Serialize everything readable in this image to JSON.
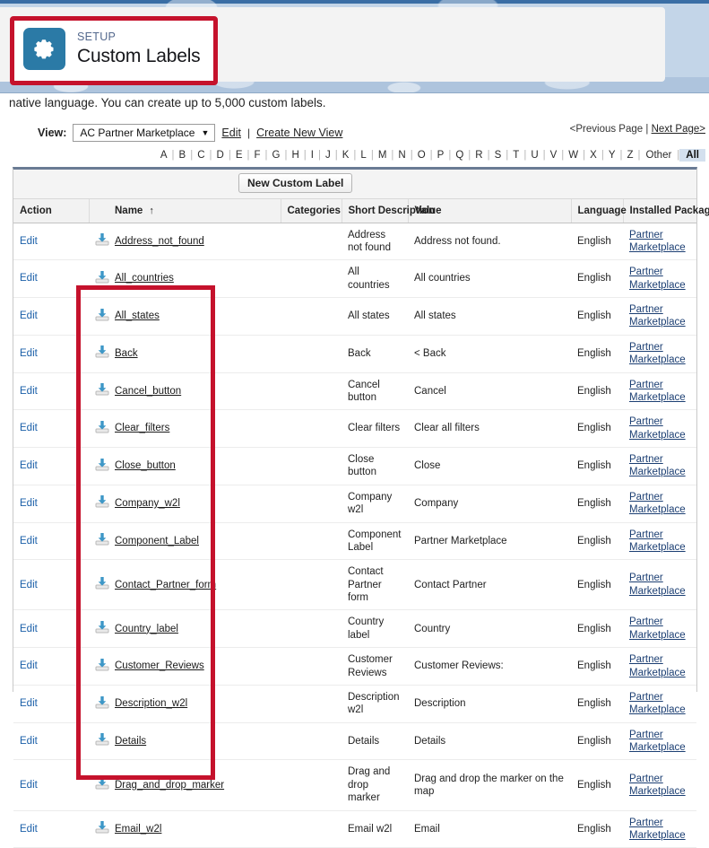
{
  "header": {
    "eyebrow": "SETUP",
    "title": "Custom Labels",
    "gear_icon": "gear-icon"
  },
  "intro": {
    "text": "native language. You can create up to 5,000 custom labels."
  },
  "view_bar": {
    "label": "View:",
    "selected_view": "AC Partner Marketplace",
    "caret": "▼",
    "edit_label": "Edit",
    "separator": "|",
    "create_view_label": "Create New View"
  },
  "paging": {
    "previous": "<Previous Page",
    "separator": "|",
    "next": "Next Page>"
  },
  "alpha_filter": {
    "letters": [
      "A",
      "B",
      "C",
      "D",
      "E",
      "F",
      "G",
      "H",
      "I",
      "J",
      "K",
      "L",
      "M",
      "N",
      "O",
      "P",
      "Q",
      "R",
      "S",
      "T",
      "U",
      "V",
      "W",
      "X",
      "Y",
      "Z"
    ],
    "other_label": "Other",
    "all_label": "All",
    "active": "All"
  },
  "toolbar": {
    "new_label_button": "New Custom Label"
  },
  "table": {
    "columns": [
      "Action",
      "",
      "Name",
      "Categories",
      "Short Description",
      "Value",
      "Language",
      "Installed Package"
    ],
    "sort_indicator": "↑",
    "sorted_column": "Name",
    "rows": [
      {
        "action": "Edit",
        "name": "Address_not_found",
        "categories": "",
        "short_description": "Address not found",
        "value": "Address not found.",
        "language": "English",
        "package": "Partner Marketplace"
      },
      {
        "action": "Edit",
        "name": "All_countries",
        "categories": "",
        "short_description": "All countries",
        "value": "All countries",
        "language": "English",
        "package": "Partner Marketplace"
      },
      {
        "action": "Edit",
        "name": "All_states",
        "categories": "",
        "short_description": "All states",
        "value": "All states",
        "language": "English",
        "package": "Partner Marketplace"
      },
      {
        "action": "Edit",
        "name": "Back",
        "categories": "",
        "short_description": "Back",
        "value": "< Back",
        "language": "English",
        "package": "Partner Marketplace"
      },
      {
        "action": "Edit",
        "name": "Cancel_button",
        "categories": "",
        "short_description": "Cancel button",
        "value": "Cancel",
        "language": "English",
        "package": "Partner Marketplace"
      },
      {
        "action": "Edit",
        "name": "Clear_filters",
        "categories": "",
        "short_description": "Clear filters",
        "value": "Clear all filters",
        "language": "English",
        "package": "Partner Marketplace"
      },
      {
        "action": "Edit",
        "name": "Close_button",
        "categories": "",
        "short_description": "Close button",
        "value": "Close",
        "language": "English",
        "package": "Partner Marketplace"
      },
      {
        "action": "Edit",
        "name": "Company_w2l",
        "categories": "",
        "short_description": "Company w2l",
        "value": "Company",
        "language": "English",
        "package": "Partner Marketplace"
      },
      {
        "action": "Edit",
        "name": "Component_Label",
        "categories": "",
        "short_description": "Component Label",
        "value": "Partner Marketplace",
        "language": "English",
        "package": "Partner Marketplace"
      },
      {
        "action": "Edit",
        "name": "Contact_Partner_form",
        "categories": "",
        "short_description": "Contact Partner form",
        "value": "Contact Partner",
        "language": "English",
        "package": "Partner Marketplace"
      },
      {
        "action": "Edit",
        "name": "Country_label",
        "categories": "",
        "short_description": "Country label",
        "value": "Country",
        "language": "English",
        "package": "Partner Marketplace"
      },
      {
        "action": "Edit",
        "name": "Customer_Reviews",
        "categories": "",
        "short_description": "Customer Reviews",
        "value": "Customer Reviews:",
        "language": "English",
        "package": "Partner Marketplace"
      },
      {
        "action": "Edit",
        "name": "Description_w2l",
        "categories": "",
        "short_description": "Description w2l",
        "value": "Description",
        "language": "English",
        "package": "Partner Marketplace"
      },
      {
        "action": "Edit",
        "name": "Details",
        "categories": "",
        "short_description": "Details",
        "value": "Details",
        "language": "English",
        "package": "Partner Marketplace"
      },
      {
        "action": "Edit",
        "name": "Drag_and_drop_marker",
        "categories": "",
        "short_description": "Drag and drop marker",
        "value": "Drag and drop the marker on the map",
        "language": "English",
        "package": "Partner Marketplace"
      },
      {
        "action": "Edit",
        "name": "Email_w2l",
        "categories": "",
        "short_description": "Email w2l",
        "value": "Email",
        "language": "English",
        "package": "Partner Marketplace"
      }
    ]
  },
  "colors": {
    "annotation_red": "#c5122c",
    "setup_tile_blue": "#2b7aa6",
    "link_blue": "#1a5fa8",
    "header_band_blue": "#3a6ea5"
  }
}
